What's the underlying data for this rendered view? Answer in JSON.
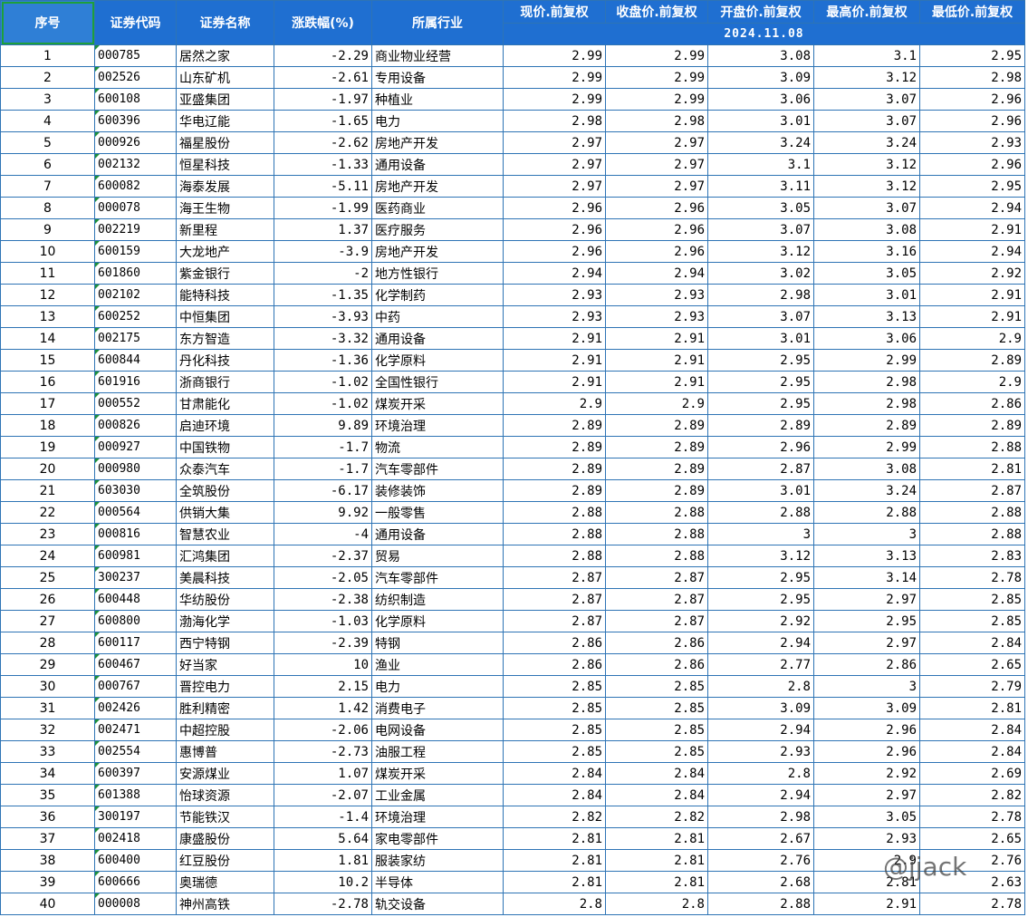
{
  "header": {
    "seq": "序号",
    "code": "证券代码",
    "name": "证券名称",
    "change": "涨跌幅(%)",
    "industry": "所属行业",
    "price": "现价.前复权",
    "close": "收盘价.前复权",
    "open": "开盘价.前复权",
    "high": "最高价.前复权",
    "low": "最低价.前复权",
    "date": "2024.11.08"
  },
  "rows": [
    [
      "1",
      "000785",
      "居然之家",
      "-2.29",
      "商业物业经营",
      "2.99",
      "2.99",
      "3.08",
      "3.1",
      "2.95"
    ],
    [
      "2",
      "002526",
      "山东矿机",
      "-2.61",
      "专用设备",
      "2.99",
      "2.99",
      "3.09",
      "3.12",
      "2.98"
    ],
    [
      "3",
      "600108",
      "亚盛集团",
      "-1.97",
      "种植业",
      "2.99",
      "2.99",
      "3.06",
      "3.07",
      "2.96"
    ],
    [
      "4",
      "600396",
      "华电辽能",
      "-1.65",
      "电力",
      "2.98",
      "2.98",
      "3.01",
      "3.07",
      "2.96"
    ],
    [
      "5",
      "000926",
      "福星股份",
      "-2.62",
      "房地产开发",
      "2.97",
      "2.97",
      "3.24",
      "3.24",
      "2.93"
    ],
    [
      "6",
      "002132",
      "恒星科技",
      "-1.33",
      "通用设备",
      "2.97",
      "2.97",
      "3.1",
      "3.12",
      "2.96"
    ],
    [
      "7",
      "600082",
      "海泰发展",
      "-5.11",
      "房地产开发",
      "2.97",
      "2.97",
      "3.11",
      "3.12",
      "2.95"
    ],
    [
      "8",
      "000078",
      "海王生物",
      "-1.99",
      "医药商业",
      "2.96",
      "2.96",
      "3.05",
      "3.07",
      "2.94"
    ],
    [
      "9",
      "002219",
      "新里程",
      "1.37",
      "医疗服务",
      "2.96",
      "2.96",
      "3.07",
      "3.08",
      "2.91"
    ],
    [
      "10",
      "600159",
      "大龙地产",
      "-3.9",
      "房地产开发",
      "2.96",
      "2.96",
      "3.12",
      "3.16",
      "2.94"
    ],
    [
      "11",
      "601860",
      "紫金银行",
      "-2",
      "地方性银行",
      "2.94",
      "2.94",
      "3.02",
      "3.05",
      "2.92"
    ],
    [
      "12",
      "002102",
      "能特科技",
      "-1.35",
      "化学制药",
      "2.93",
      "2.93",
      "2.98",
      "3.01",
      "2.91"
    ],
    [
      "13",
      "600252",
      "中恒集团",
      "-3.93",
      "中药",
      "2.93",
      "2.93",
      "3.07",
      "3.13",
      "2.91"
    ],
    [
      "14",
      "002175",
      "东方智造",
      "-3.32",
      "通用设备",
      "2.91",
      "2.91",
      "3.01",
      "3.06",
      "2.9"
    ],
    [
      "15",
      "600844",
      "丹化科技",
      "-1.36",
      "化学原料",
      "2.91",
      "2.91",
      "2.95",
      "2.99",
      "2.89"
    ],
    [
      "16",
      "601916",
      "浙商银行",
      "-1.02",
      "全国性银行",
      "2.91",
      "2.91",
      "2.95",
      "2.98",
      "2.9"
    ],
    [
      "17",
      "000552",
      "甘肃能化",
      "-1.02",
      "煤炭开采",
      "2.9",
      "2.9",
      "2.95",
      "2.98",
      "2.86"
    ],
    [
      "18",
      "000826",
      "启迪环境",
      "9.89",
      "环境治理",
      "2.89",
      "2.89",
      "2.89",
      "2.89",
      "2.89"
    ],
    [
      "19",
      "000927",
      "中国铁物",
      "-1.7",
      "物流",
      "2.89",
      "2.89",
      "2.96",
      "2.99",
      "2.88"
    ],
    [
      "20",
      "000980",
      "众泰汽车",
      "-1.7",
      "汽车零部件",
      "2.89",
      "2.89",
      "2.87",
      "3.08",
      "2.81"
    ],
    [
      "21",
      "603030",
      "全筑股份",
      "-6.17",
      "装修装饰",
      "2.89",
      "2.89",
      "3.01",
      "3.24",
      "2.87"
    ],
    [
      "22",
      "000564",
      "供销大集",
      "9.92",
      "一般零售",
      "2.88",
      "2.88",
      "2.88",
      "2.88",
      "2.88"
    ],
    [
      "23",
      "000816",
      "智慧农业",
      "-4",
      "通用设备",
      "2.88",
      "2.88",
      "3",
      "3",
      "2.88"
    ],
    [
      "24",
      "600981",
      "汇鸿集团",
      "-2.37",
      "贸易",
      "2.88",
      "2.88",
      "3.12",
      "3.13",
      "2.83"
    ],
    [
      "25",
      "300237",
      "美晨科技",
      "-2.05",
      "汽车零部件",
      "2.87",
      "2.87",
      "2.95",
      "3.14",
      "2.78"
    ],
    [
      "26",
      "600448",
      "华纺股份",
      "-2.38",
      "纺织制造",
      "2.87",
      "2.87",
      "2.95",
      "2.97",
      "2.85"
    ],
    [
      "27",
      "600800",
      "渤海化学",
      "-1.03",
      "化学原料",
      "2.87",
      "2.87",
      "2.92",
      "2.95",
      "2.85"
    ],
    [
      "28",
      "600117",
      "西宁特钢",
      "-2.39",
      "特钢",
      "2.86",
      "2.86",
      "2.94",
      "2.97",
      "2.84"
    ],
    [
      "29",
      "600467",
      "好当家",
      "10",
      "渔业",
      "2.86",
      "2.86",
      "2.77",
      "2.86",
      "2.65"
    ],
    [
      "30",
      "000767",
      "晋控电力",
      "2.15",
      "电力",
      "2.85",
      "2.85",
      "2.8",
      "3",
      "2.79"
    ],
    [
      "31",
      "002426",
      "胜利精密",
      "1.42",
      "消费电子",
      "2.85",
      "2.85",
      "3.09",
      "3.09",
      "2.81"
    ],
    [
      "32",
      "002471",
      "中超控股",
      "-2.06",
      "电网设备",
      "2.85",
      "2.85",
      "2.94",
      "2.96",
      "2.84"
    ],
    [
      "33",
      "002554",
      "惠博普",
      "-2.73",
      "油服工程",
      "2.85",
      "2.85",
      "2.93",
      "2.96",
      "2.84"
    ],
    [
      "34",
      "600397",
      "安源煤业",
      "1.07",
      "煤炭开采",
      "2.84",
      "2.84",
      "2.8",
      "2.92",
      "2.69"
    ],
    [
      "35",
      "601388",
      "怡球资源",
      "-2.07",
      "工业金属",
      "2.84",
      "2.84",
      "2.94",
      "2.97",
      "2.82"
    ],
    [
      "36",
      "300197",
      "节能铁汉",
      "-1.4",
      "环境治理",
      "2.82",
      "2.82",
      "2.98",
      "3.05",
      "2.78"
    ],
    [
      "37",
      "002418",
      "康盛股份",
      "5.64",
      "家电零部件",
      "2.81",
      "2.81",
      "2.67",
      "2.93",
      "2.65"
    ],
    [
      "38",
      "600400",
      "红豆股份",
      "1.81",
      "服装家纺",
      "2.81",
      "2.81",
      "2.76",
      "2.9",
      "2.76"
    ],
    [
      "39",
      "600666",
      "奥瑞德",
      "10.2",
      "半导体",
      "2.81",
      "2.81",
      "2.68",
      "2.81",
      "2.63"
    ],
    [
      "40",
      "000008",
      "神州高铁",
      "-2.78",
      "轨交设备",
      "2.8",
      "2.8",
      "2.88",
      "2.91",
      "2.78"
    ]
  ],
  "watermark": "@jjack"
}
